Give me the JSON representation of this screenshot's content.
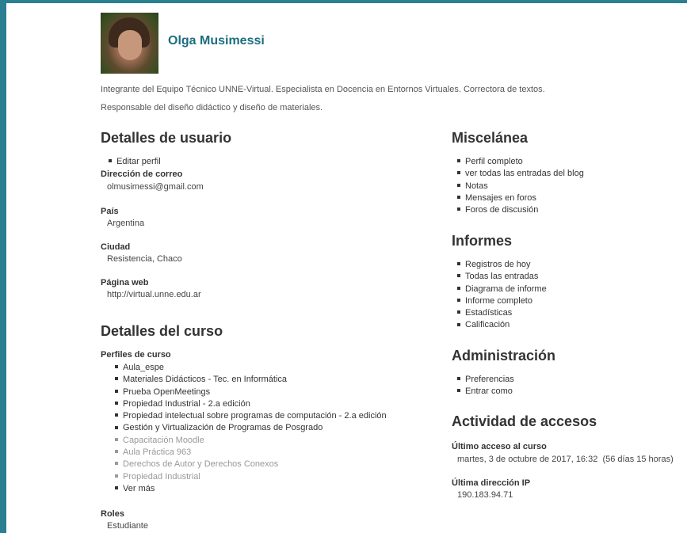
{
  "profile": {
    "name": "Olga Musimessi",
    "description_line1": "Integrante del Equipo Técnico UNNE-Virtual. Especialista en Docencia en Entornos Virtuales. Correctora de textos.",
    "description_line2": "Responsable del diseño didáctico y diseño de materiales."
  },
  "user_details": {
    "heading": "Detalles de usuario",
    "edit_link": "Editar perfil",
    "email_label": "Dirección de correo",
    "email_value": "olmusimessi@gmail.com",
    "country_label": "País",
    "country_value": "Argentina",
    "city_label": "Ciudad",
    "city_value": "Resistencia, Chaco",
    "web_label": "Página web",
    "web_value": "http://virtual.unne.edu.ar"
  },
  "course_details": {
    "heading": "Detalles del curso",
    "profiles_label": "Perfiles de curso",
    "courses": [
      "Aula_espe",
      "Materiales Didácticos - Tec. en Informática",
      "Prueba OpenMeetings",
      "Propiedad Industrial - 2.a edición",
      "Propiedad intelectual sobre programas de computación - 2.a edición",
      "Gestión y Virtualización de Programas de Posgrado",
      "Capacitación Moodle",
      "Aula Práctica 963",
      "Derechos de Autor y Derechos Conexos",
      "Propiedad Industrial",
      "Ver más"
    ],
    "roles_label": "Roles",
    "roles_value": "Estudiante"
  },
  "misc": {
    "heading": "Miscelánea",
    "items": [
      "Perfil completo",
      "ver todas las entradas del blog",
      "Notas",
      "Mensajes en foros",
      "Foros de discusión"
    ]
  },
  "reports": {
    "heading": "Informes",
    "items": [
      "Registros de hoy",
      "Todas las entradas",
      "Diagrama de informe",
      "Informe completo",
      "Estadísticas",
      "Calificación"
    ]
  },
  "admin": {
    "heading": "Administración",
    "items": [
      "Preferencias",
      "Entrar como"
    ]
  },
  "access": {
    "heading": "Actividad de accesos",
    "last_access_label": "Último acceso al curso",
    "last_access_value": "martes, 3 de octubre de 2017, 16:32  (56 días 15 horas)",
    "last_ip_label": "Última dirección IP",
    "last_ip_value": "190.183.94.71"
  },
  "colors": {
    "frame": "#2a7f91",
    "name": "#1b6e7f",
    "dim_link": "#999999"
  }
}
